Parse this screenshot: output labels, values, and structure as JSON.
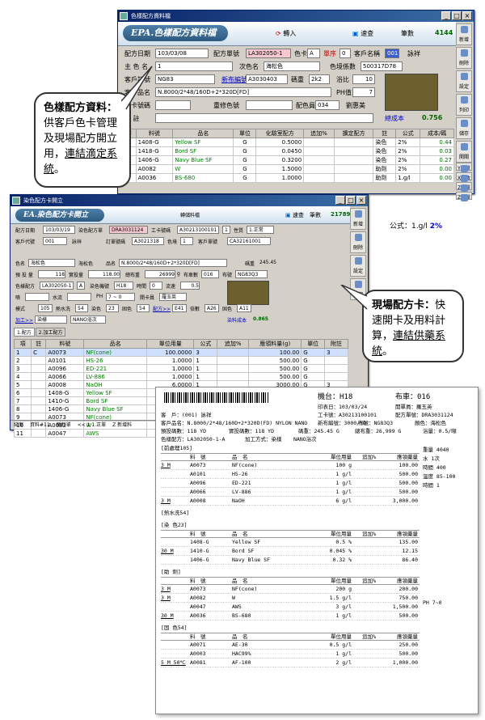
{
  "w1": {
    "title": "色樣配方資料檔",
    "logo": "EPA.色樣配方資料檔",
    "import_label": "轉入",
    "quick_label": "速查",
    "count_label": "筆數",
    "count": "4144",
    "f": {
      "date_l": "配方日期",
      "date": "103/03/08",
      "formula_l": "配方單號",
      "formula": "LA302050-1",
      "cardno_l": "色卡",
      "cardno": "A",
      "grade_l": "單序",
      "grade": "0",
      "cust_l": "客戶名稱",
      "cust": "001",
      "cust_name": "詠祥",
      "main_l": "主 色 名",
      "main": "1",
      "second_l": "次色名",
      "second": "海松色",
      "sys_l": "色境係數",
      "sys": "500317D78",
      "custno_l": "客戶訂號",
      "custno": "NG83",
      "newno_l": "新布編號",
      "newno": "A3030403",
      "spec_l": "碼重",
      "spec": "2k2",
      "ratio_l": "浴比",
      "ratio": "10",
      "prod_l": "客戶品名",
      "prod": "N.8000/2*48/160D+2*320D[FD]",
      "ph_l": "PH值",
      "ph": "7",
      "work_l": "工卡號碼",
      "rec_l": "重修色號",
      "colorno_l": "配色員",
      "colorno": "034",
      "staff": "劉惠美",
      "note_l": "備 註",
      "total_l": "總成本",
      "total": "0.756"
    },
    "cols": [
      "序",
      "料號",
      "品名",
      "單位",
      "化驗室配方",
      "追加%",
      "擴定配方",
      "註",
      "公式",
      "成本/碼"
    ],
    "rows": [
      [
        "1",
        "1408-G",
        "Yellow SF",
        "G",
        "0.5000",
        "",
        "",
        "染色",
        "2%",
        "0.44"
      ],
      [
        "2",
        "1418-G",
        "Bord SF",
        "G",
        "0.0450",
        "",
        "",
        "染色",
        "2%",
        "0.03"
      ],
      [
        "3",
        "1406-G",
        "Navy Blue SF",
        "G",
        "0.3200",
        "",
        "",
        "染色",
        "2%",
        "0.27"
      ],
      [
        "4",
        "A0082",
        "W",
        "G",
        "1.5000",
        "",
        "",
        "助劑",
        "2%",
        "0.00"
      ],
      [
        "5",
        "A0036",
        "BS-680",
        "G",
        "1.0000",
        "",
        "",
        "助劑",
        "1.g/l",
        "0.00"
      ]
    ],
    "tools": [
      "新增",
      "刪除",
      "設定",
      "列印",
      "儲存",
      "開關"
    ],
    "mini": [
      "Y新單",
      "X修改",
      "Z依單",
      "Z加單"
    ]
  },
  "w2": {
    "title": "染色配方卡開立",
    "logo": "EA.染色配方卡開立",
    "transfer": "轉儲料檔",
    "quick_label": "速查",
    "count_label": "筆數",
    "count": "21789",
    "formula_label": "公式：1.g/l",
    "pct": "2%",
    "f": {
      "date_l": "配方日期",
      "date": "103/03/19",
      "formula_l": "染色配方單",
      "formula": "DRA3031124",
      "work_l": "工卡號碼",
      "work": "A30213100101",
      "n1": "1",
      "prop_l": "性質",
      "prop": "1.正常",
      "cust_l": "客戶代號",
      "cust": "001",
      "cust_name": "詠祥",
      "order_l": "訂單號碼",
      "order": "A3021318",
      "color_l": "色境",
      "color": "1",
      "custno_l": "客戶單號",
      "custno": "CA32161001",
      "cname_l": "色名",
      "cname": "海松色",
      "cname2_l": "海松色",
      "prod_l": "品名",
      "prod": "N.8000/2*48/160D+2*320D[FD]",
      "ydw_l": "碼重",
      "ydw": "245.45",
      "plan_l": "預 投 量",
      "plan": "118",
      "real_l": "實投量",
      "real": "118.00",
      "tot_l": "總布重",
      "tot": "26999",
      "g": "g",
      "rate_l": "布車數",
      "rate": "016",
      "cloth_l": "布號",
      "cloth": "NG83Q3",
      "recipe_l": "色樣配方",
      "recipe": "LA302050-1",
      "a": "A",
      "mach_l": "染色機號",
      "mach": "H18",
      "time_l": "時間",
      "time": "0",
      "speed_l": "流速",
      "speed": "0.5",
      "jet_l": "噴",
      "water_l": "水流",
      "ph_l": "PH",
      "ph": "7 ~ 0",
      "op_l": "開卡員",
      "op": "羅玉英",
      "mode_l": "模式",
      "mode": "105",
      "wat_l": "熱水洗",
      "wat": "54",
      "dye_l": "染色",
      "dye": "23",
      "fix_l": "固色",
      "fix": "54",
      "dyec_l": "配方>>",
      "dyec": "E41",
      "cb_l": "倍數",
      "cb": "A26",
      "fab_l": "固色",
      "fab": "A11",
      "proc_l": "加工>>",
      "proc": "染樣",
      "nano": "NANO浴次",
      "cost_l": "染料成本",
      "cost": "0.865"
    },
    "tabs": [
      "1.配方",
      "2.加工配方"
    ],
    "cols": [
      "項",
      "註",
      "料號",
      "品名",
      "單位用量",
      "公式",
      "追加%",
      "應領料量(g)",
      "單位",
      "附註"
    ],
    "rows": [
      [
        "1",
        "C",
        "A0073",
        "NF(cone)",
        "100.0000",
        "3",
        "",
        "100.00",
        "G",
        "3"
      ],
      [
        "2",
        "",
        "A0101",
        "HS-26",
        "1.0000",
        "1",
        "",
        "500.00",
        "G",
        ""
      ],
      [
        "3",
        "",
        "A0096",
        "ED-221",
        "1.0000",
        "1",
        "",
        "500.00",
        "G",
        ""
      ],
      [
        "4",
        "",
        "A0066",
        "LV-886",
        "1.0000",
        "1",
        "",
        "500.00",
        "G",
        ""
      ],
      [
        "5",
        "",
        "A0008",
        "NaOH",
        "6.0000",
        "1",
        "",
        "3000.00",
        "G",
        "3"
      ],
      [
        "6",
        "",
        "1408-G",
        "Yellow SF",
        "0.5000",
        "2",
        "",
        "135.00",
        "G",
        ""
      ],
      [
        "7",
        "",
        "1410-G",
        "Bord SF",
        "0.0450",
        "2",
        "",
        "12.15",
        "G",
        "30"
      ],
      [
        "8",
        "",
        "1406-G",
        "Navy Blue SF",
        "0.3200",
        "2",
        "",
        "86.40",
        "G",
        ""
      ],
      [
        "9",
        "",
        "A0073",
        "NF(cone)",
        "",
        "",
        "",
        "",
        "",
        ""
      ],
      [
        "10",
        "",
        "A0082",
        "W",
        "",
        "",
        "",
        "",
        "",
        ""
      ],
      [
        "11",
        "",
        "A0047",
        "AWS",
        "",
        "",
        "",
        "",
        "",
        ""
      ]
    ],
    "status": [
      "結案",
      "資料#11",
      "稱料單",
      "<< 1 1.正單",
      "Z 新增料"
    ],
    "tools": [
      "新增",
      "刪除",
      "設定",
      "列印"
    ]
  },
  "callout1": {
    "title": "色樣配方資料：",
    "body": "供客戶色卡管理及現場配方開立用，",
    "link": "連結滴定系統",
    "end": "。"
  },
  "callout2": {
    "title": "現場配方卡：",
    "body": "快速開卡及用料計算，",
    "link": "連結供藥系統",
    "end": "。"
  },
  "report": {
    "machine_l": "機台：",
    "machine": "H18",
    "car_l": "布車：",
    "car": "016",
    "print_l": "印表日：",
    "print": "103/03/24",
    "opener_l": "開單員：",
    "opener": "羅玉英",
    "cust_l": "客　戶：",
    "cust": "(001) 詠祥",
    "work_l": "工卡號：",
    "work": "A30213100101",
    "formula_l": "配方單號：",
    "formula": "DRA3031124",
    "prod_l": "客戶品名：",
    "prod": "N.8000/2*48/160D+2*320D(FD) NYLON NANO",
    "newno_l": "新布編號：",
    "newno": "3000/YD",
    "cno_l": "布號：",
    "cno": "NG83Q3",
    "color_l": "顏色：",
    "color": "海松色",
    "plan_l": "預投碼數：",
    "plan": "118 YD",
    "real_l": "實投碼數：",
    "real": "118 YD",
    "ydw_l": "碼重：",
    "ydw": "245.45 G",
    "tot_l": "總布重：",
    "tot": "26,999 G",
    "bath_l": "浴量：",
    "bath": "0.5/噸",
    "recipe_l": "色樣配方：",
    "recipe": "LA302050-1-A",
    "proc_l": "加工方式：",
    "proc": "染樣",
    "nano": "NANO浴次",
    "side": {
      "w_l": "重量",
      "w": "4040",
      "water_l": "水",
      "water": "1次",
      "dye_l": "溫度",
      "dye": "85-100",
      "time_l": "時間",
      "time": "1",
      "ph_l": "PH",
      "ph": "7~0",
      "seqno_l": "時間",
      "seqno": "400"
    },
    "head": [
      "料　號",
      "品　名",
      "單位用量",
      "追加%",
      "應領藥量"
    ],
    "sections": [
      {
        "title": "[前處理105]",
        "rows": [
          {
            "qty": "3 M",
            "code": "A0073",
            "name": "NF(cone)",
            "unit": "100 g",
            "add": "",
            "amt": "100.00"
          },
          {
            "qty": "",
            "code": "A0101",
            "name": "HS-26",
            "unit": "1 g/l",
            "add": "",
            "amt": "500.00"
          },
          {
            "qty": "",
            "code": "A0096",
            "name": "ED-221",
            "unit": "1 g/l",
            "add": "",
            "amt": "500.00"
          },
          {
            "qty": "",
            "code": "A0066",
            "name": "LV-886",
            "unit": "1 g/l",
            "add": "",
            "amt": "500.00"
          },
          {
            "qty": "3 M",
            "code": "A0008",
            "name": "NaOH",
            "unit": "6 g/l",
            "add": "",
            "amt": "3,000.00"
          }
        ]
      },
      {
        "title": "[熱水洗54]",
        "rows": []
      },
      {
        "title": "[染 色23]",
        "rows": [
          {
            "qty": "",
            "code": "1408-G",
            "name": "Yellow SF",
            "unit": "0.5 %",
            "add": "",
            "amt": "135.00"
          },
          {
            "qty": "30 M",
            "code": "1410-G",
            "name": "Bord SF",
            "unit": "0.045 %",
            "add": "",
            "amt": "12.15"
          },
          {
            "qty": "",
            "code": "1406-G",
            "name": "Navy Blue SF",
            "unit": "0.32 %",
            "add": "",
            "amt": "86.40"
          }
        ]
      },
      {
        "title": "[助 劑]",
        "rows": [
          {
            "qty": "3 M",
            "code": "A0073",
            "name": "NF(cone)",
            "unit": "200 g",
            "add": "",
            "amt": "200.00"
          },
          {
            "qty": "3 M",
            "code": "A0082",
            "name": "W",
            "unit": "1.5 g/l",
            "add": "",
            "amt": "750.00"
          },
          {
            "qty": "",
            "code": "A0047",
            "name": "AWS",
            "unit": "3 g/l",
            "add": "",
            "amt": "1,500.00"
          },
          {
            "qty": "30 M",
            "code": "A0036",
            "name": "BS-680",
            "unit": "1 g/l",
            "add": "",
            "amt": "500.00"
          }
        ]
      },
      {
        "title": "[固 色54]",
        "rows": [
          {
            "qty": "",
            "code": "A0071",
            "name": "AE-30",
            "unit": "0.5 g/l",
            "add": "",
            "amt": "250.00"
          },
          {
            "qty": "",
            "code": "A0003",
            "name": "HAC99%",
            "unit": "1 g/l",
            "add": "",
            "amt": "500.00"
          },
          {
            "qty": "5 M 50℃",
            "code": "A0081",
            "name": "AF-100",
            "unit": "2 g/l",
            "add": "",
            "amt": "1,000.00"
          }
        ]
      }
    ]
  }
}
